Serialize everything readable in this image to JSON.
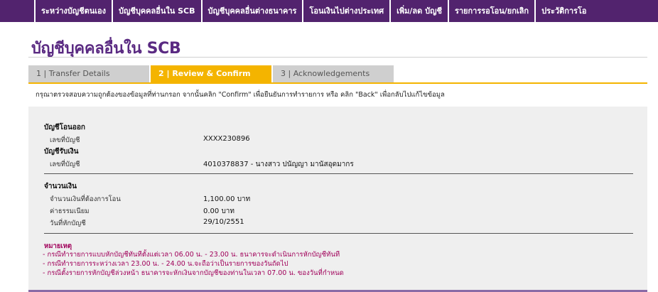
{
  "nav": {
    "items": [
      "ระหว่างบัญชีตนเอง",
      "บัญชีบุคคลอื่นใน SCB",
      "บัญชีบุคคลอื่นต่างธนาคาร",
      "โอนเงินไปต่างประเทศ",
      "เพิ่ม/ลด บัญชี",
      "รายการรอโอน/ยกเลิก",
      "ประวัติการโอ"
    ]
  },
  "page": {
    "title": "บัญชีบุคคลอื่นใน SCB",
    "instruction": "กรุณาตรวจสอบความถูกต้องของข้อมูลที่ท่านกรอก จากนั้นคลิก \"Confirm\" เพื่อยืนยันการทำรายการ หรือ คลิก \"Back\" เพื่อกลับไปแก้ไขข้อมูล"
  },
  "steps": [
    {
      "label": "1 | Transfer Details"
    },
    {
      "label": "2 | Review & Confirm"
    },
    {
      "label": "3 | Acknowledgements"
    }
  ],
  "summary": {
    "from_heading": "บัญชีโอนออก",
    "from_account_label": "เลขที่บัญชี",
    "from_account_value": "XXXX230896",
    "to_heading": "บัญชีรับเงิน",
    "to_account_label": "เลขที่บัญชี",
    "to_account_value": "4010378837 - นางสาว ปนัญญา มานัสอุดมากร",
    "amount_heading": "จำนวนเงิน",
    "amount_label": "จำนวนเงินที่ต้องการโอน",
    "amount_value": "1,100.00 บาท",
    "fee_label": "ค่าธรรมเนียม",
    "fee_value": "0.00 บาท",
    "date_label": "วันที่หักบัญชี",
    "date_value": "29/10/2551"
  },
  "remarks": {
    "heading": "หมายเหตุ",
    "lines": [
      "- กรณีทำรายการแบบหักบัญชีทันทีตั้งแต่เวลา 06.00 น. - 23.00 น. ธนาคารจะดำเนินการหักบัญชีทันที",
      "- กรณีทำรายการระหว่างเวลา 23.00 น. - 24.00 น.จะถือว่าเป็นรายการของวันถัดไป",
      "- กรณีตั้งรายการหักบัญชีล่วงหน้า ธนาคารจะหักเงินจากบัญชีของท่านในเวลา 07.00 น. ของวันที่กำหนด"
    ]
  },
  "colors": {
    "brand_purple": "#52236e",
    "title_purple": "#5a2a82",
    "step_active": "#f4b400",
    "remark_text": "#a0005a"
  }
}
